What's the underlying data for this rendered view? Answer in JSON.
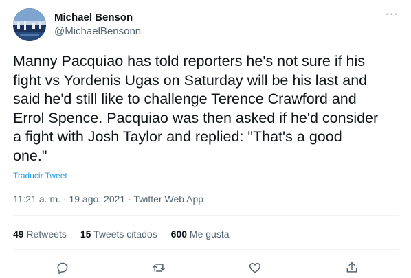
{
  "author": {
    "display_name": "Michael Benson",
    "handle": "@MichaelBensonn"
  },
  "more_label": "···",
  "tweet_text": "Manny Pacquiao has told reporters he's not sure if his\nfight vs Yordenis Ugas on Saturday will be his last and\nsaid he'd still like to challenge Terence Crawford and\nErrol Spence. Pacquiao was then asked if he'd consider\na fight with Josh Taylor and replied: \"That's a good\none.\"",
  "translate_label": "Traducir Tweet",
  "timestamp_line": "11:21 a. m. · 19 ago. 2021 · Twitter Web App",
  "stats": {
    "retweets": {
      "count": "49",
      "label": "Retweets"
    },
    "quotes": {
      "count": "15",
      "label": "Tweets citados"
    },
    "likes": {
      "count": "600",
      "label": "Me gusta"
    }
  },
  "actions": {
    "reply_icon": "reply-icon",
    "retweet_icon": "retweet-icon",
    "like_icon": "like-icon",
    "share_icon": "share-icon"
  },
  "colors": {
    "text": "#0f1419",
    "secondary": "#536471",
    "link": "#1d9bf0",
    "divider": "#eff3f4"
  }
}
